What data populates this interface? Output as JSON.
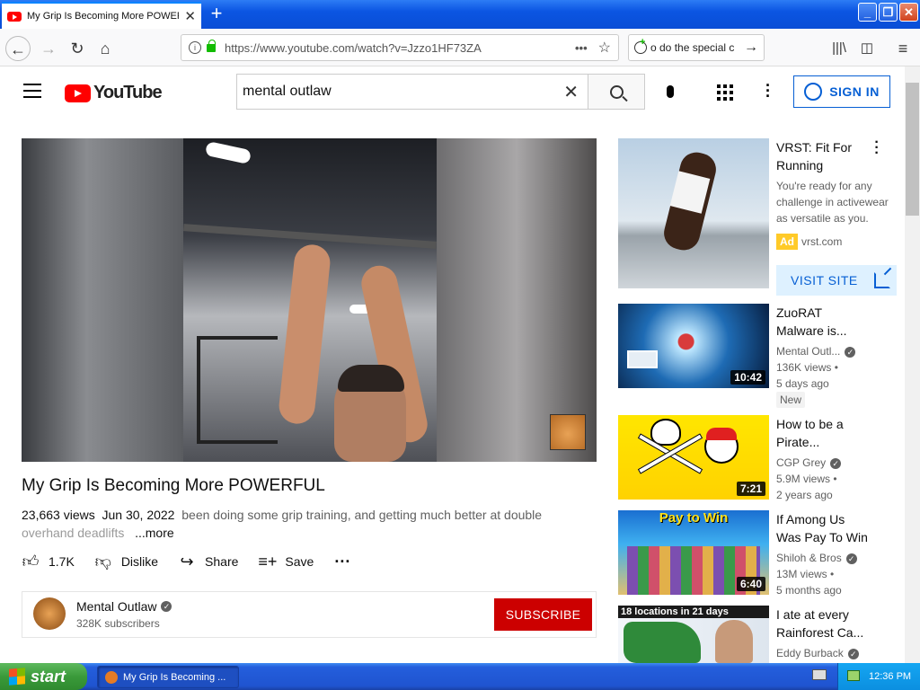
{
  "browser": {
    "tab_title": "My Grip Is Becoming More POWERFUL",
    "new_tab": "+",
    "url": "https://www.youtube.com/watch?v=Jzzo1HF73ZA",
    "search_text": "o do the special c",
    "window_buttons": {
      "minimize": "_",
      "restore": "❐",
      "close": "✕"
    }
  },
  "youtube": {
    "logo_text": "YouTube",
    "search_query": "mental outlaw",
    "sign_in": "SIGN IN"
  },
  "video": {
    "title": "My Grip Is Becoming More POWERFUL",
    "views": "23,663 views",
    "date": "Jun 30, 2022",
    "description_line1": "been doing some grip training, and getting much better at double",
    "description_line2": "overhand deadlifts",
    "more": "...more",
    "likes": "1.7K",
    "dislike": "Dislike",
    "share": "Share",
    "save": "Save",
    "channel_name": "Mental Outlaw",
    "subscribers": "328K subscribers",
    "subscribe": "SUBSCRIBE"
  },
  "sidebar": {
    "ad": {
      "title_line1": "VRST: Fit For",
      "title_line2": "Running",
      "desc_line1": "You're ready for any",
      "desc_line2": "challenge in activewear",
      "desc_line3": "as versatile as you.",
      "badge": "Ad",
      "domain": "vrst.com",
      "visit": "VISIT SITE"
    },
    "items": [
      {
        "title_line1": "ZuoRAT",
        "title_line2": "Malware is...",
        "channel": "Mental Outl...",
        "views": "136K views •",
        "age": "5 days ago",
        "badge": "New",
        "duration": "10:42"
      },
      {
        "title_line1": "How to be a",
        "title_line2": "Pirate...",
        "channel": "CGP Grey",
        "views": "5.9M views •",
        "age": "2 years ago",
        "duration": "7:21"
      },
      {
        "title_line1": "If Among Us",
        "title_line2": "Was Pay To Win",
        "channel": "Shiloh & Bros",
        "views": "13M views •",
        "age": "5 months ago",
        "duration": "6:40",
        "thumb_text": "Pay to Win"
      },
      {
        "title_line1": "I ate at every",
        "title_line2": "Rainforest Ca...",
        "channel": "Eddy Burback",
        "thumb_text": "18 locations in 21 days"
      }
    ]
  },
  "taskbar": {
    "start": "start",
    "window_item": "My Grip Is Becoming ...",
    "clock": "12:36 PM"
  },
  "colors": {
    "youtube_red": "#ff0000",
    "subscribe_red": "#cc0000",
    "link_blue": "#065fd4",
    "xp_taskbar_blue": "#245edc",
    "xp_start_green": "#3a9a3a"
  },
  "icons": [
    "youtube-favicon",
    "close-tab-icon",
    "back-icon",
    "forward-icon",
    "reload-icon",
    "home-icon",
    "info-icon",
    "lock-icon",
    "page-actions-icon",
    "bookmark-star-icon",
    "search-engine-icon",
    "arrow-right-icon",
    "library-icon",
    "sidebar-icon",
    "menu-icon",
    "hamburger-icon",
    "search-icon",
    "clear-icon",
    "mic-icon",
    "apps-icon",
    "more-vert-icon",
    "account-icon",
    "like-icon",
    "dislike-icon",
    "share-icon",
    "save-playlist-icon",
    "more-horiz-icon",
    "verified-icon",
    "external-link-icon",
    "windows-flag-icon",
    "keyboard-icon",
    "network-icon"
  ]
}
